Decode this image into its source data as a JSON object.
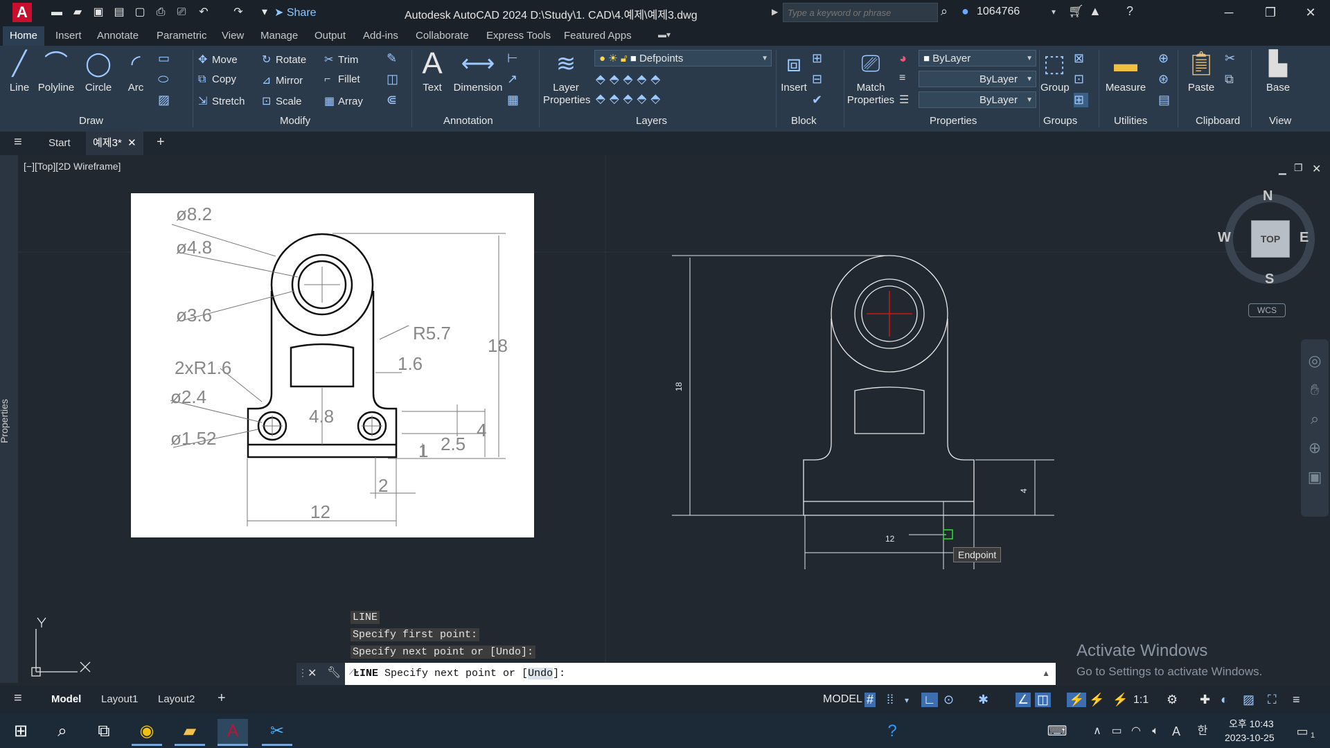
{
  "titlebar": {
    "app_logo": "A",
    "share": "Share",
    "title": "Autodesk AutoCAD 2024    D:\\Study\\1. CAD\\4.예제\\예제3.dwg",
    "search_placeholder": "Type a keyword or phrase",
    "user": "1064766"
  },
  "ribbon_tabs": [
    "Home",
    "Insert",
    "Annotate",
    "Parametric",
    "View",
    "Manage",
    "Output",
    "Add-ins",
    "Collaborate",
    "Express Tools",
    "Featured Apps"
  ],
  "ribbon": {
    "draw": {
      "title": "Draw",
      "line": "Line",
      "polyline": "Polyline",
      "circle": "Circle",
      "arc": "Arc"
    },
    "modify": {
      "title": "Modify",
      "move": "Move",
      "rotate": "Rotate",
      "trim": "Trim",
      "copy": "Copy",
      "mirror": "Mirror",
      "fillet": "Fillet",
      "stretch": "Stretch",
      "scale": "Scale",
      "array": "Array"
    },
    "annotation": {
      "title": "Annotation",
      "text": "Text",
      "dimension": "Dimension"
    },
    "layers": {
      "title": "Layers",
      "layer_properties": "Layer Properties",
      "current_layer": "Defpoints"
    },
    "block": {
      "title": "Block",
      "insert": "Insert"
    },
    "properties": {
      "title": "Properties",
      "match": "Match Properties",
      "color": "ByLayer",
      "linetype": "ByLayer",
      "lineweight": "ByLayer"
    },
    "groups": {
      "title": "Groups",
      "group": "Group"
    },
    "utilities": {
      "title": "Utilities",
      "measure": "Measure"
    },
    "clipboard": {
      "title": "Clipboard",
      "paste": "Paste"
    },
    "view": {
      "title": "View",
      "base": "Base"
    }
  },
  "file_tabs": {
    "start": "Start",
    "current": "예제3*"
  },
  "viewport": {
    "label": "[−][Top][2D Wireframe]"
  },
  "reference_drawing": {
    "labels": [
      "ø8.2",
      "ø4.8",
      "ø3.6",
      "2xR1.6",
      "ø2.4",
      "ø1.52",
      "R5.7",
      "1.6",
      "18",
      "4.8",
      "4",
      "2.5",
      "1",
      "2",
      "12"
    ]
  },
  "cad_drawing": {
    "dim_18": "18",
    "dim_4": "4",
    "dim_12": "12",
    "tooltip": "Endpoint"
  },
  "viewcube": {
    "n": "N",
    "s": "S",
    "e": "E",
    "w": "W",
    "top": "TOP",
    "wcs": "WCS"
  },
  "side_panel": {
    "properties": "Properties"
  },
  "command": {
    "history": [
      "LINE",
      "Specify first point:",
      "Specify next point or [Undo]:"
    ],
    "prompt_cmd": "LINE",
    "prompt_text": "Specify next point or [",
    "prompt_opt": "Undo",
    "prompt_end": "]:"
  },
  "watermark": {
    "line1": "Activate Windows",
    "line2": "Go to Settings to activate Windows."
  },
  "layout_tabs": [
    "Model",
    "Layout1",
    "Layout2"
  ],
  "status": {
    "model": "MODEL",
    "scale": "1:1"
  },
  "taskbar": {
    "time": "오후 10:43",
    "date": "2023-10-25",
    "ime": "한",
    "notif": "1"
  },
  "ucs": {
    "x": "X",
    "y": "Y"
  }
}
